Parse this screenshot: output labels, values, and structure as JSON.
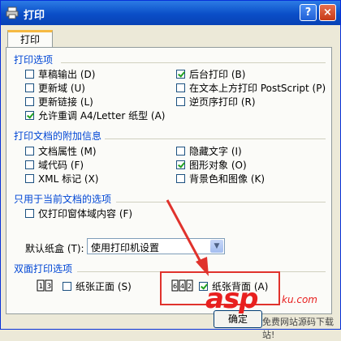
{
  "window": {
    "title": "打印",
    "help_label": "?",
    "close_label": "×"
  },
  "tabs": [
    {
      "label": "打印"
    }
  ],
  "print_options": {
    "title": "打印选项",
    "left": [
      {
        "label": "草稿输出 (D)",
        "checked": false
      },
      {
        "label": "更新域 (U)",
        "checked": false
      },
      {
        "label": "更新链接 (L)",
        "checked": false
      },
      {
        "label": "允许重调 A4/Letter 纸型 (A)",
        "checked": true
      }
    ],
    "right": [
      {
        "label": "后台打印 (B)",
        "checked": true
      },
      {
        "label": "在文本上方打印 PostScript (P)",
        "checked": false
      },
      {
        "label": "逆页序打印 (R)",
        "checked": false
      }
    ]
  },
  "extra_info": {
    "title": "打印文档的附加信息",
    "left": [
      {
        "label": "文档属性 (M)",
        "checked": false
      },
      {
        "label": "域代码 (F)",
        "checked": false
      },
      {
        "label": "XML 标记 (X)",
        "checked": false
      }
    ],
    "right": [
      {
        "label": "隐藏文字 (I)",
        "checked": false
      },
      {
        "label": "图形对象 (O)",
        "checked": true
      },
      {
        "label": "背景色和图像 (K)",
        "checked": false
      }
    ]
  },
  "current_doc": {
    "title": "只用于当前文档的选项",
    "items": [
      {
        "label": "仅打印窗体域内容 (F)",
        "checked": false
      }
    ]
  },
  "tray": {
    "label": "默认纸盒 (T):",
    "value": "使用打印机设置"
  },
  "duplex": {
    "title": "双面打印选项",
    "front": {
      "label": "纸张正面 (S)",
      "checked": false,
      "icon": "1 3"
    },
    "back": {
      "label": "纸张背面 (A)",
      "checked": true,
      "icon": "6 4 2"
    }
  },
  "ok_label": "确定",
  "watermark": {
    "brand": "asp",
    "domain": "ku.com",
    "sub": "免费网站源码下载站!"
  },
  "colors": {
    "title_blue": "#0a4ec7",
    "group_title": "#0046d5",
    "highlight": "#e0322c"
  }
}
